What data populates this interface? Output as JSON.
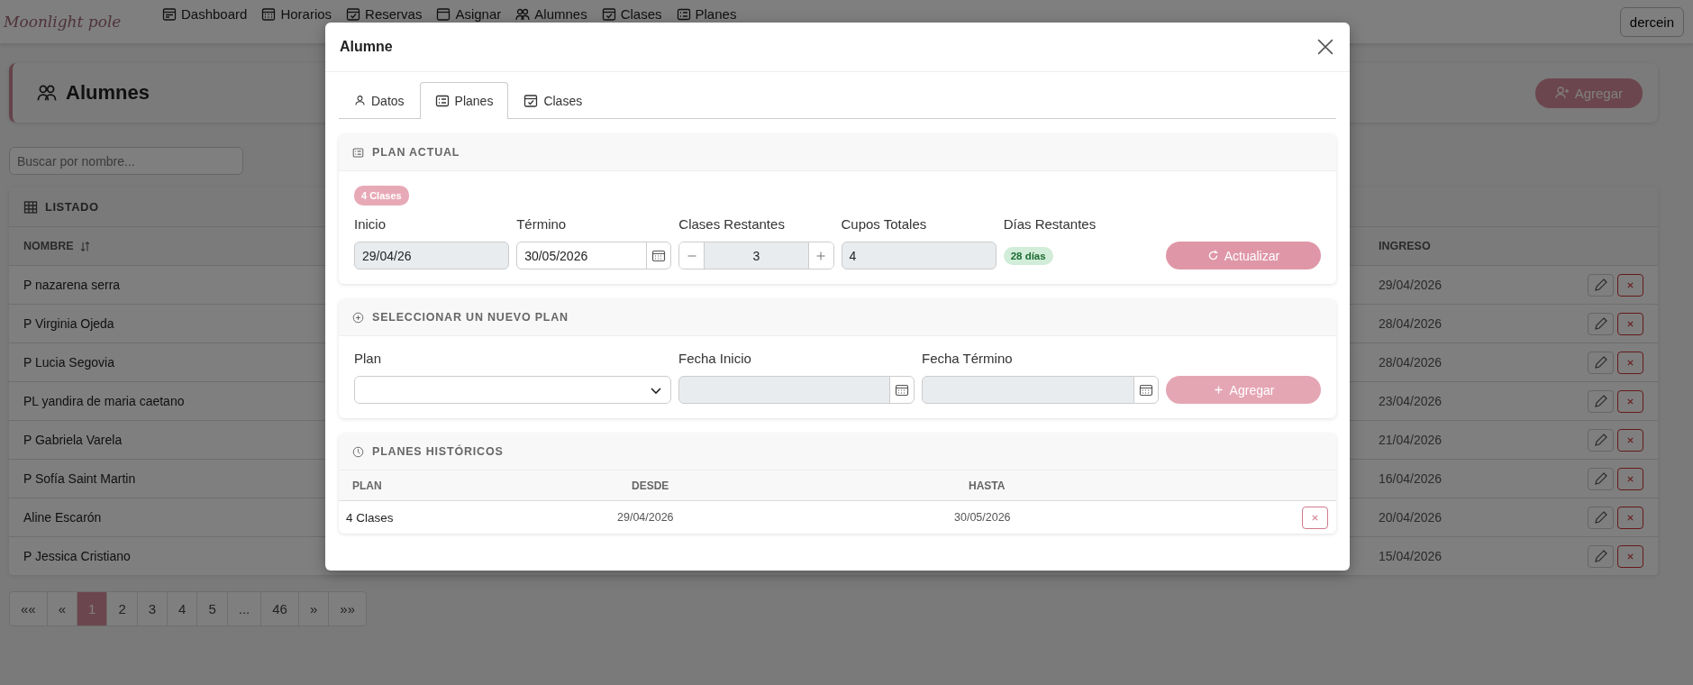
{
  "navbar": {
    "logo": "Moonlight pole",
    "items": [
      {
        "label": "Dashboard"
      },
      {
        "label": "Horarios"
      },
      {
        "label": "Reservas"
      },
      {
        "label": "Asignar"
      },
      {
        "label": "Alumnes"
      },
      {
        "label": "Clases"
      },
      {
        "label": "Planes"
      }
    ],
    "user_button": "dercein"
  },
  "page": {
    "title": "Alumnes",
    "add_button": "Agregar",
    "search": {
      "placeholder": "Buscar por nombre..."
    },
    "listing": {
      "title": "LISTADO",
      "columns": [
        "NOMBRE",
        "INGRESO"
      ],
      "rows": [
        {
          "name": "P nazarena serra",
          "ingreso": "29/04/2026"
        },
        {
          "name": "P Virginia Ojeda",
          "ingreso": "28/04/2026"
        },
        {
          "name": "P Lucia Segovia",
          "ingreso": "28/04/2026"
        },
        {
          "name": "PL yandira de maria caetano",
          "ingreso": "23/04/2026"
        },
        {
          "name": "P Gabriela Varela",
          "ingreso": "21/04/2026"
        },
        {
          "name": "P Sofía Saint Martin",
          "ingreso": "16/04/2026"
        },
        {
          "name": "Aline Escarón",
          "ingreso": "20/04/2026"
        },
        {
          "name": "P Jessica Cristiano",
          "ingreso": "15/04/2026"
        }
      ]
    },
    "pagination": [
      {
        "label": "««",
        "selected": false
      },
      {
        "label": "«",
        "selected": false
      },
      {
        "label": "1",
        "selected": true
      },
      {
        "label": "2",
        "selected": false
      },
      {
        "label": "3",
        "selected": false
      },
      {
        "label": "4",
        "selected": false
      },
      {
        "label": "5",
        "selected": false
      },
      {
        "label": "...",
        "selected": false
      },
      {
        "label": "46",
        "selected": false
      },
      {
        "label": "»",
        "selected": false
      },
      {
        "label": "»»",
        "selected": false
      }
    ]
  },
  "modal": {
    "title": "Alumne",
    "tabs": [
      {
        "label": "Datos",
        "selected": false
      },
      {
        "label": "Planes",
        "selected": true
      },
      {
        "label": "Clases",
        "selected": false
      }
    ],
    "plan_actual": {
      "title": "PLAN ACTUAL",
      "badge": "4 Clases",
      "fields": [
        {
          "kind": "text",
          "label": "Inicio",
          "value": "29/04/26",
          "disabled": true
        },
        {
          "kind": "date",
          "label": "Término",
          "value": "30/05/2026",
          "disabled": false
        },
        {
          "kind": "stepper",
          "label": "Clases Restantes",
          "value": "3",
          "disabled": false
        },
        {
          "kind": "text",
          "label": "Cupos Totales",
          "value": "4",
          "disabled": true
        },
        {
          "kind": "badge",
          "label": "Días Restantes",
          "value": "28 días",
          "disabled": false
        }
      ],
      "button": {
        "label": "Actualizar",
        "disabled": false
      }
    },
    "new_plan": {
      "title": "SELECCIONAR UN NUEVO PLAN",
      "fields": [
        {
          "kind": "select",
          "label": "Plan",
          "disabled": false
        },
        {
          "kind": "date",
          "label": "Fecha Inicio",
          "disabled": true
        },
        {
          "kind": "date",
          "label": "Fecha Término",
          "disabled": true
        }
      ],
      "button": {
        "label": "Agregar",
        "disabled": true
      }
    },
    "history": {
      "title": "PLANES HISTÓRICOS",
      "columns": [
        "PLAN",
        "DESDE",
        "HASTA"
      ],
      "rows": [
        {
          "plan": "4 Clases",
          "desde": "29/04/2026",
          "hasta": "30/05/2026"
        }
      ]
    }
  }
}
